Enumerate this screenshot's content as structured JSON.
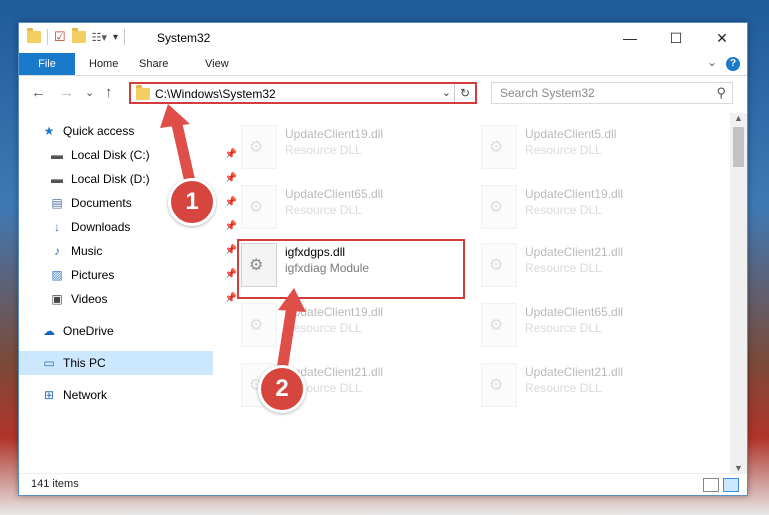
{
  "window": {
    "title": "System32",
    "controls": {
      "minimize": "—",
      "maximize": "☐",
      "close": "✕"
    }
  },
  "ribbon": {
    "tabs": [
      "File",
      "Home",
      "Share",
      "View"
    ],
    "expand": "⌄",
    "help": "?"
  },
  "navigation": {
    "back": "←",
    "forward": "→",
    "recent": "⌄",
    "up": "↑",
    "address": "C:\\Windows\\System32",
    "search_placeholder": "Search System32"
  },
  "sidebar": {
    "items": [
      {
        "label": "Quick access",
        "icon": "star-icon",
        "pinned": false
      },
      {
        "label": "Local Disk (C:)",
        "icon": "drive-icon",
        "pinned": true
      },
      {
        "label": "Local Disk (D:)",
        "icon": "drive-icon",
        "pinned": true
      },
      {
        "label": "Documents",
        "icon": "document-icon",
        "pinned": true
      },
      {
        "label": "Downloads",
        "icon": "download-icon",
        "pinned": true
      },
      {
        "label": "Music",
        "icon": "music-icon",
        "pinned": true
      },
      {
        "label": "Pictures",
        "icon": "pictures-icon",
        "pinned": true
      },
      {
        "label": "Videos",
        "icon": "video-icon",
        "pinned": true
      },
      {
        "label": "OneDrive",
        "icon": "cloud-icon",
        "pinned": false
      },
      {
        "label": "This PC",
        "icon": "computer-icon",
        "pinned": false,
        "selected": true
      },
      {
        "label": "Network",
        "icon": "network-icon",
        "pinned": false
      }
    ]
  },
  "files": {
    "items": [
      {
        "name": "UpdateClient19.dll",
        "desc": "Resource DLL",
        "faded": true
      },
      {
        "name": "UpdateClient5.dll",
        "desc": "Resource DLL",
        "faded": true
      },
      {
        "name": "UpdateClient65.dll",
        "desc": "Resource DLL",
        "faded": true
      },
      {
        "name": "UpdateClient19.dll",
        "desc": "Resource DLL",
        "faded": true
      },
      {
        "name": "igfxdgps.dll",
        "desc": "igfxdiag Module",
        "faded": false,
        "highlighted": true
      },
      {
        "name": "UpdateClient21.dll",
        "desc": "Resource DLL",
        "faded": true
      },
      {
        "name": "UpdateClient19.dll",
        "desc": "Resource DLL",
        "faded": true
      },
      {
        "name": "UpdateClient65.dll",
        "desc": "Resource DLL",
        "faded": true
      },
      {
        "name": "UpdateClient21.dll",
        "desc": "Resource DLL",
        "faded": true
      },
      {
        "name": "UpdateClient21.dll",
        "desc": "Resource DLL",
        "faded": true
      }
    ]
  },
  "status": {
    "count": "141 items"
  },
  "annotations": {
    "badge1": "1",
    "badge2": "2",
    "color": "#d6463f"
  }
}
